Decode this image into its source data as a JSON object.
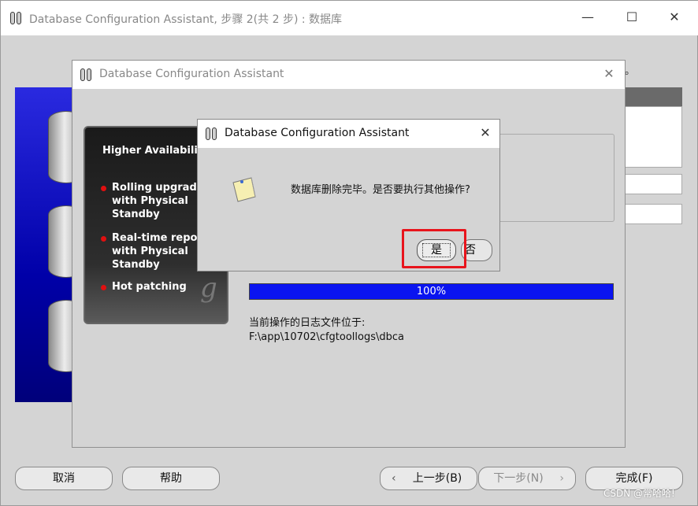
{
  "main_window": {
    "title": "Database Configuration Assistant, 步骤 2(共 2 步) : 数据库",
    "minimize": "—",
    "maximize": "☐",
    "close": "✕",
    "right_text": "。"
  },
  "footer": {
    "cancel": "取消",
    "help": "帮助",
    "back": "上一步(B)",
    "next": "下一步(N)",
    "finish": "完成(F)"
  },
  "progress_dialog": {
    "title": "Database Configuration Assistant",
    "close": "✕",
    "promo": {
      "heading": "Higher Availabili",
      "items": [
        "Rolling upgrade\nwith Physical\nStandby",
        "Real-time repor\nwith Physical\nStandby",
        "Hot patching"
      ],
      "logo_letter": "g"
    },
    "progress": {
      "percent": 100,
      "label": "100%"
    },
    "log_label": "当前操作的日志文件位于:",
    "log_path": "F:\\app\\10702\\cfgtoollogs\\dbca"
  },
  "confirm_dialog": {
    "title": "Database Configuration Assistant",
    "close": "✕",
    "message": "数据库删除完毕。是否要执行其他操作?",
    "yes": "是",
    "no": "否"
  },
  "watermark": "CSDN @常哈哈!",
  "colors": {
    "progress": "#0a14f0",
    "highlight": "#e8141c"
  }
}
